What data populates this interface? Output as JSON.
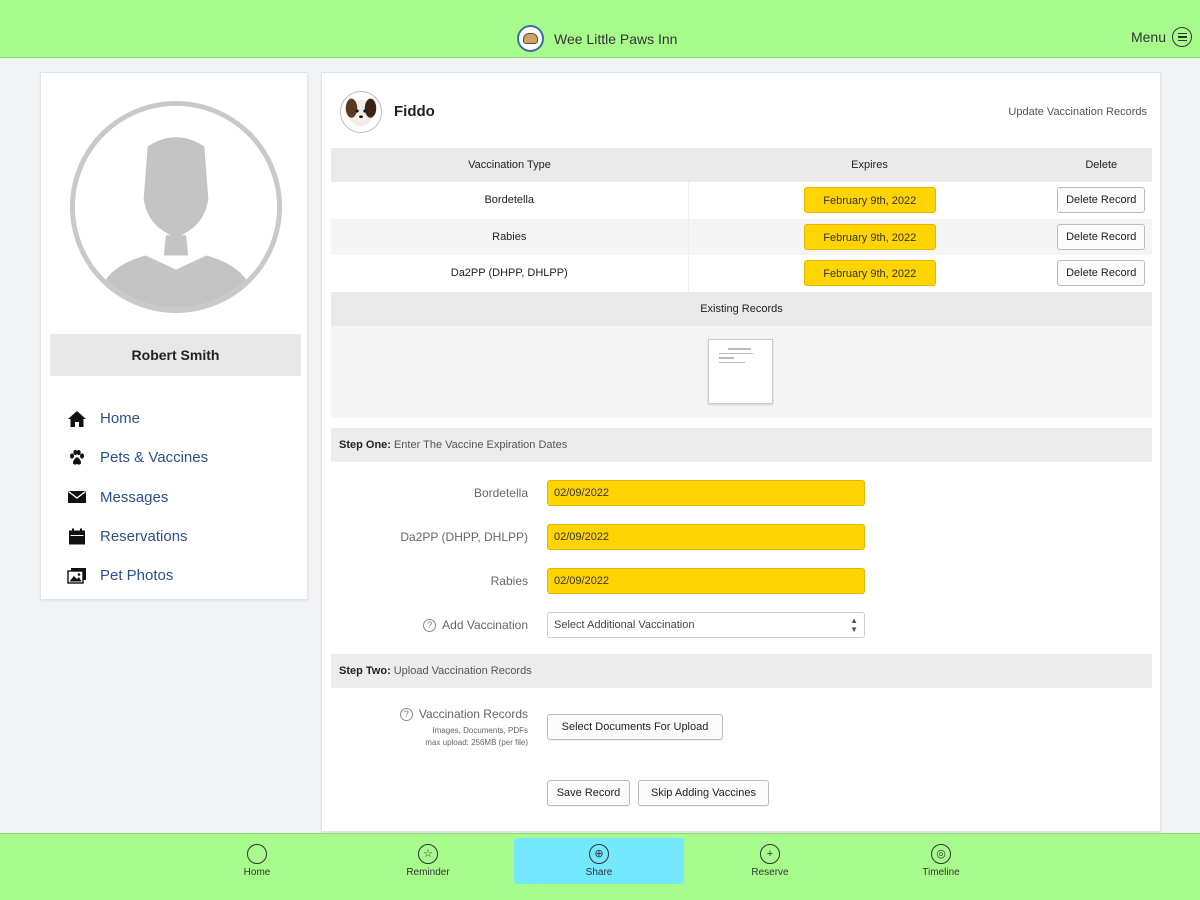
{
  "app": {
    "title": "Wee Little Paws Inn",
    "menu_label": "Menu"
  },
  "sidebar": {
    "user_name": "Robert Smith",
    "items": [
      {
        "label": "Home",
        "icon": "home-icon"
      },
      {
        "label": "Pets & Vaccines",
        "icon": "paw-icon"
      },
      {
        "label": "Messages",
        "icon": "envelope-icon"
      },
      {
        "label": "Reservations",
        "icon": "calendar-icon"
      },
      {
        "label": "Pet Photos",
        "icon": "photo-icon"
      }
    ]
  },
  "pet": {
    "name": "Fiddo",
    "update_link": "Update Vaccination Records"
  },
  "vaccination_table": {
    "headers": {
      "type": "Vaccination Type",
      "expires": "Expires",
      "delete": "Delete"
    },
    "rows": [
      {
        "type": "Bordetella",
        "expires": "February 9th, 2022",
        "delete_label": "Delete Record"
      },
      {
        "type": "Rabies",
        "expires": "February 9th, 2022",
        "delete_label": "Delete Record"
      },
      {
        "type": "Da2PP (DHPP, DHLPP)",
        "expires": "February 9th, 2022",
        "delete_label": "Delete Record"
      }
    ],
    "existing_records_label": "Existing Records"
  },
  "step_one": {
    "title": "Step One:",
    "text": "Enter The Vaccine Expiration Dates",
    "fields": [
      {
        "label": "Bordetella",
        "value": "02/09/2022"
      },
      {
        "label": "Da2PP (DHPP, DHLPP)",
        "value": "02/09/2022"
      },
      {
        "label": "Rabies",
        "value": "02/09/2022"
      }
    ],
    "add_vaccination_label": "Add Vaccination",
    "add_vaccination_select": "Select Additional Vaccination",
    "info_glyph": "?"
  },
  "step_two": {
    "title": "Step Two:",
    "text": "Upload Vaccination Records",
    "records_label": "Vaccination Records",
    "note_line1": "Images, Documents, PDFs",
    "note_line2": "max upload: 256MB (per file)",
    "upload_button": "Select Documents For Upload"
  },
  "actions": {
    "save": "Save Record",
    "skip": "Skip Adding Vaccines"
  },
  "tabbar": {
    "active": "Share",
    "tabs": [
      {
        "label": "Home",
        "icon": "home-circle-icon",
        "glyph": ""
      },
      {
        "label": "Reminder",
        "icon": "reminder-icon",
        "glyph": "☆"
      },
      {
        "label": "Share",
        "icon": "share-icon",
        "glyph": "⊕"
      },
      {
        "label": "Reserve",
        "icon": "plus-circle-icon",
        "glyph": "+"
      },
      {
        "label": "Timeline",
        "icon": "timeline-icon",
        "glyph": "◎"
      }
    ]
  },
  "colors": {
    "bar_green": "#a8fc8c",
    "active_tab": "#74e8ff",
    "highlight_yellow": "#ffd400",
    "link_blue": "#2d4f8a"
  }
}
